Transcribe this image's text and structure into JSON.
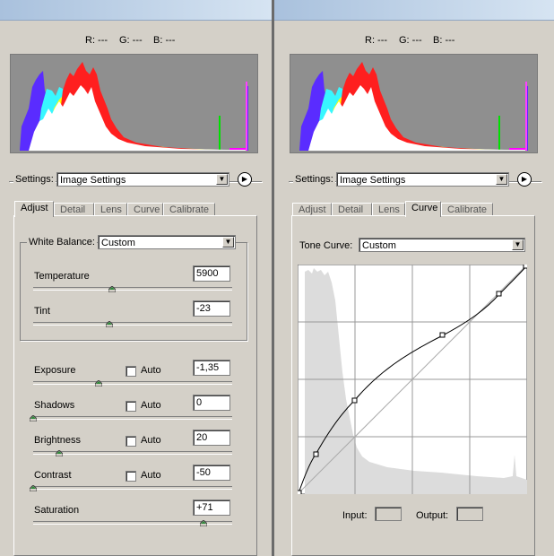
{
  "readout": {
    "r": "R: ---",
    "g": "G: ---",
    "b": "B: ---"
  },
  "settings": {
    "label": "Settings:",
    "value": "Image Settings"
  },
  "tabs": [
    "Adjust",
    "Detail",
    "Lens",
    "Curve",
    "Calibrate"
  ],
  "left": {
    "active_tab": "Adjust",
    "white_balance": {
      "label": "White Balance:",
      "value": "Custom"
    },
    "sliders": [
      {
        "label": "Temperature",
        "value": "5900",
        "auto": false,
        "position": 0.395
      },
      {
        "label": "Tint",
        "value": "-23",
        "auto": false,
        "position": 0.385
      },
      {
        "label": "Exposure",
        "value": "-1,35",
        "auto": true,
        "auto_label": "Auto",
        "position": 0.33
      },
      {
        "label": "Shadows",
        "value": "0",
        "auto": true,
        "auto_label": "Auto",
        "position": 0.0
      },
      {
        "label": "Brightness",
        "value": "20",
        "auto": true,
        "auto_label": "Auto",
        "position": 0.13
      },
      {
        "label": "Contrast",
        "value": "-50",
        "auto": true,
        "auto_label": "Auto",
        "position": 0.0
      },
      {
        "label": "Saturation",
        "value": "+71",
        "auto": false,
        "position": 0.855
      }
    ]
  },
  "right": {
    "active_tab": "Curve",
    "tone_curve": {
      "label": "Tone Curve:",
      "value": "Custom"
    },
    "input_label": "Input:",
    "output_label": "Output:"
  }
}
